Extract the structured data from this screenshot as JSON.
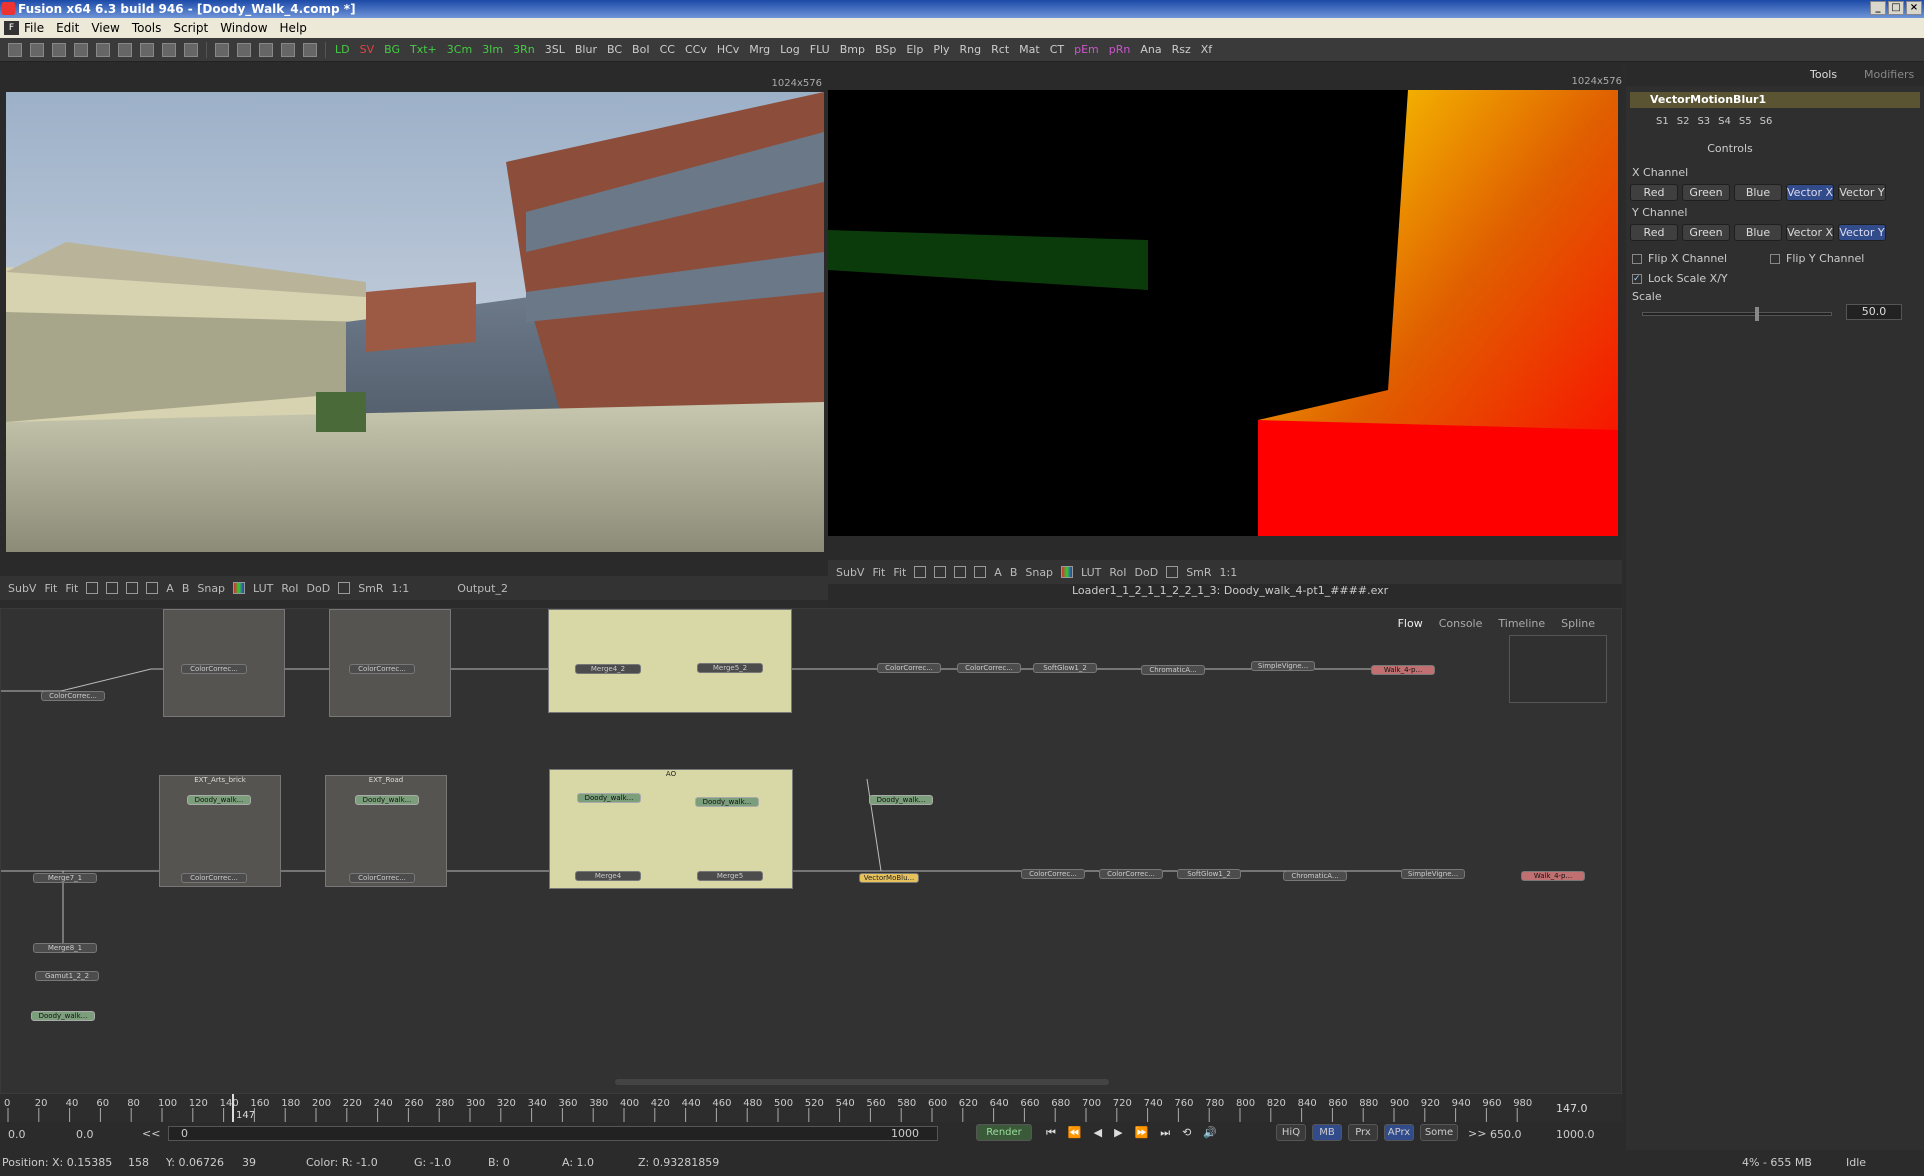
{
  "window": {
    "title": "Fusion x64 6.3 build 946 - [Doody_Walk_4.comp *]"
  },
  "menu": [
    "File",
    "Edit",
    "View",
    "Tools",
    "Script",
    "Window",
    "Help"
  ],
  "toolbar": {
    "tools": [
      {
        "l": "LD",
        "c": "g"
      },
      {
        "l": "SV",
        "c": "r"
      },
      {
        "l": "BG",
        "c": "g"
      },
      {
        "l": "Txt+",
        "c": "g"
      },
      {
        "l": "3Cm",
        "c": "g"
      },
      {
        "l": "3Im",
        "c": "g"
      },
      {
        "l": "3Rn",
        "c": "g"
      },
      {
        "l": "3SL",
        "c": ""
      },
      {
        "l": "Blur",
        "c": ""
      },
      {
        "l": "BC",
        "c": ""
      },
      {
        "l": "BoI",
        "c": ""
      },
      {
        "l": "CC",
        "c": ""
      },
      {
        "l": "CCv",
        "c": ""
      },
      {
        "l": "HCv",
        "c": ""
      },
      {
        "l": "Mrg",
        "c": ""
      },
      {
        "l": "Log",
        "c": ""
      },
      {
        "l": "FLU",
        "c": ""
      },
      {
        "l": "Bmp",
        "c": ""
      },
      {
        "l": "BSp",
        "c": ""
      },
      {
        "l": "Elp",
        "c": ""
      },
      {
        "l": "Ply",
        "c": ""
      },
      {
        "l": "Rng",
        "c": ""
      },
      {
        "l": "Rct",
        "c": ""
      },
      {
        "l": "Mat",
        "c": ""
      },
      {
        "l": "CT",
        "c": ""
      },
      {
        "l": "pEm",
        "c": "m"
      },
      {
        "l": "pRn",
        "c": "m"
      },
      {
        "l": "Ana",
        "c": ""
      },
      {
        "l": "Rsz",
        "c": ""
      },
      {
        "l": "Xf",
        "c": ""
      }
    ]
  },
  "viewer1": {
    "res": "1024x576",
    "bar": [
      "SubV",
      "Fit",
      "Fit",
      "Snap",
      "LUT",
      "RoI",
      "DoD",
      "SmR",
      "1:1"
    ],
    "output": "Output_2"
  },
  "viewer2": {
    "res": "1024x576",
    "bar": [
      "SubV",
      "Fit",
      "Fit",
      "Snap",
      "LUT",
      "RoI",
      "DoD",
      "SmR",
      "1:1"
    ],
    "filename": "Loader1_1_2_1_1_2_2_1_3: Doody_walk_4-pt1_####.exr"
  },
  "panel": {
    "tabs": [
      "Tools",
      "Modifiers"
    ],
    "tool": "VectorMotionBlur1",
    "slots": [
      "S1",
      "S2",
      "S3",
      "S4",
      "S5",
      "S6"
    ],
    "controls_tab": "Controls",
    "xchannel": {
      "label": "X Channel",
      "options": [
        "Red",
        "Green",
        "Blue",
        "Vector X",
        "Vector Y"
      ],
      "selected": "Vector X"
    },
    "ychannel": {
      "label": "Y Channel",
      "options": [
        "Red",
        "Green",
        "Blue",
        "Vector X",
        "Vector Y"
      ],
      "selected": "Vector Y"
    },
    "flipx": "Flip X Channel",
    "flipy": "Flip Y Channel",
    "lock": "Lock Scale X/Y",
    "scale": {
      "label": "Scale",
      "value": "50.0"
    }
  },
  "flow": {
    "tabs": [
      "Flow",
      "Console",
      "Timeline",
      "Spline"
    ],
    "groups": {
      "ext1": "EXT_Arts_brick",
      "ext2": "EXT_Road",
      "ao": "AO"
    },
    "nodes": {
      "cc": "ColorCorrec...",
      "merge": "Merge4_2",
      "merge2": "Merge5_2",
      "merge3": "Merge4",
      "merge4": "Merge5",
      "soft1": "SoftGlow1_2",
      "soft2": "SoftGlow1_2",
      "chroma": "ChromaticA...",
      "vig": "SimpleVigne...",
      "save1": "Walk_4-p...",
      "save2": "Walk_4-p...",
      "vmb": "VectorMoBlu...",
      "load": "Doody_walk...",
      "merge7": "Merge7_1",
      "merge8": "Merge8_1",
      "gamut": "Gamut1_2_2"
    }
  },
  "timeline": {
    "ticks": [
      "0",
      "20",
      "40",
      "60",
      "80",
      "100",
      "120",
      "140",
      "160",
      "180",
      "200",
      "220",
      "240",
      "260",
      "280",
      "300",
      "320",
      "340",
      "360",
      "380",
      "400",
      "420",
      "440",
      "460",
      "480",
      "500",
      "520",
      "540",
      "560",
      "580",
      "600",
      "620",
      "640",
      "660",
      "680",
      "700",
      "720",
      "740",
      "760",
      "780",
      "800",
      "820",
      "840",
      "860",
      "880",
      "900",
      "920",
      "940",
      "960",
      "980"
    ],
    "current": "147",
    "end": "147.0"
  },
  "transport": {
    "start": "0.0",
    "render_start": "0.0",
    "cur": "0",
    "end_range": "1000",
    "render": "Render",
    "btns": [
      "HiQ",
      "MB",
      "Prx",
      "APrx",
      "Some"
    ],
    "global_start": "650.0",
    "global_end": "1000.0"
  },
  "status": {
    "position": "Position:",
    "x": "X: 0.15385",
    "xi": "158",
    "y": "Y: 0.06726",
    "yi": "39",
    "color": "Color: R: -1.0",
    "g": "G: -1.0",
    "b": "B: 0",
    "a": "A: 1.0",
    "z": "Z: 0.93281859",
    "mem": "4% - 655 MB",
    "state": "Idle"
  }
}
